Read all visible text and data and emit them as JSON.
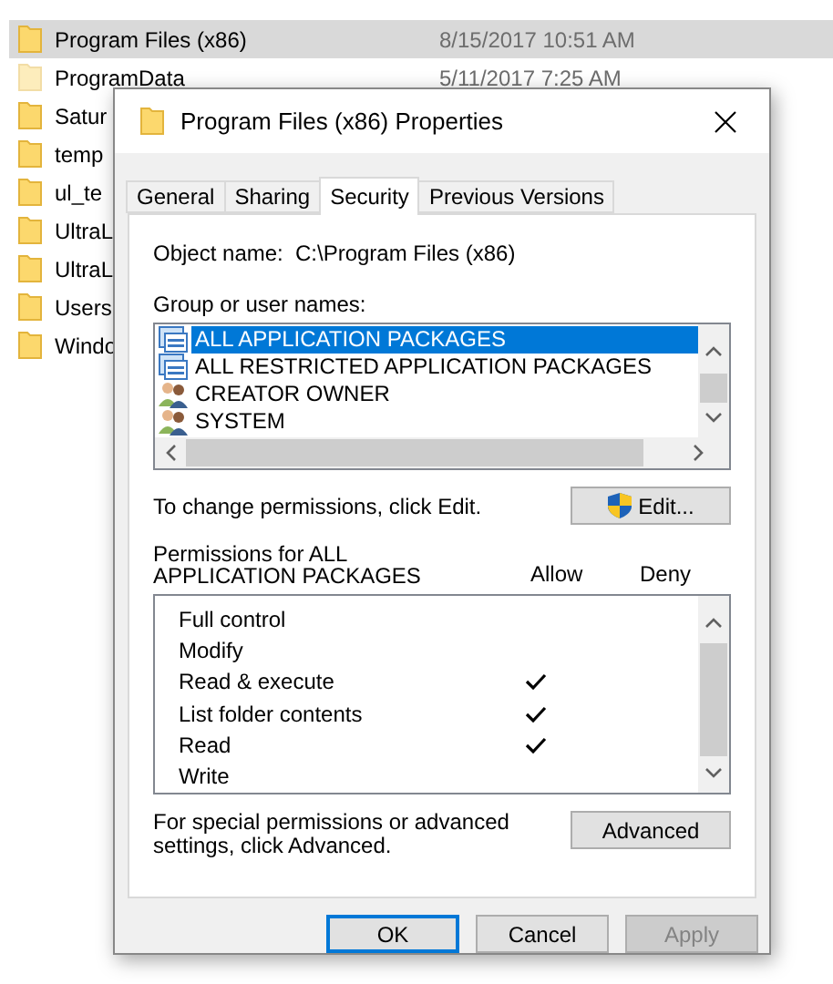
{
  "explorer": {
    "rows": [
      {
        "name": "Program Files (x86)",
        "date": "8/15/2017 10:51 AM",
        "selected": true,
        "hidden": false
      },
      {
        "name": "ProgramData",
        "date": "5/11/2017 7:25 AM",
        "selected": false,
        "hidden": true
      },
      {
        "name": "Satur",
        "selected": false,
        "hidden": false
      },
      {
        "name": "temp",
        "selected": false,
        "hidden": false
      },
      {
        "name": "ul_te",
        "selected": false,
        "hidden": false
      },
      {
        "name": "UltraL",
        "selected": false,
        "hidden": false
      },
      {
        "name": "UltraL",
        "selected": false,
        "hidden": false
      },
      {
        "name": "Users",
        "selected": false,
        "hidden": false
      },
      {
        "name": "Windo",
        "selected": false,
        "hidden": false
      }
    ]
  },
  "dialog": {
    "title": "Program Files (x86) Properties",
    "tabs": [
      {
        "label": "General",
        "selected": false
      },
      {
        "label": "Sharing",
        "selected": false
      },
      {
        "label": "Security",
        "selected": true
      },
      {
        "label": "Previous Versions",
        "selected": false
      }
    ],
    "object_label": "Object name:",
    "object_value": "C:\\Program Files (x86)",
    "groups_label": "Group or user names:",
    "groups": [
      {
        "name": "ALL APPLICATION PACKAGES",
        "kind": "package",
        "selected": true
      },
      {
        "name": "ALL RESTRICTED APPLICATION PACKAGES",
        "kind": "package",
        "selected": false
      },
      {
        "name": "CREATOR OWNER",
        "kind": "users",
        "selected": false
      },
      {
        "name": "SYSTEM",
        "kind": "users",
        "selected": false
      }
    ],
    "change_hint": "To change permissions, click Edit.",
    "edit_button": "Edit...",
    "permissions_label": "Permissions for ALL APPLICATION PACKAGES",
    "allow_header": "Allow",
    "deny_header": "Deny",
    "permissions": [
      {
        "name": "Full control",
        "allow": false,
        "deny": false
      },
      {
        "name": "Modify",
        "allow": false,
        "deny": false
      },
      {
        "name": "Read & execute",
        "allow": true,
        "deny": false
      },
      {
        "name": "List folder contents",
        "allow": true,
        "deny": false
      },
      {
        "name": "Read",
        "allow": true,
        "deny": false
      },
      {
        "name": "Write",
        "allow": false,
        "deny": false
      }
    ],
    "advanced_hint": "For special permissions or advanced settings, click Advanced.",
    "advanced_button": "Advanced",
    "buttons": [
      {
        "label": "OK",
        "default": true,
        "disabled": false
      },
      {
        "label": "Cancel",
        "default": false,
        "disabled": false
      },
      {
        "label": "Apply",
        "default": false,
        "disabled": true
      }
    ]
  }
}
